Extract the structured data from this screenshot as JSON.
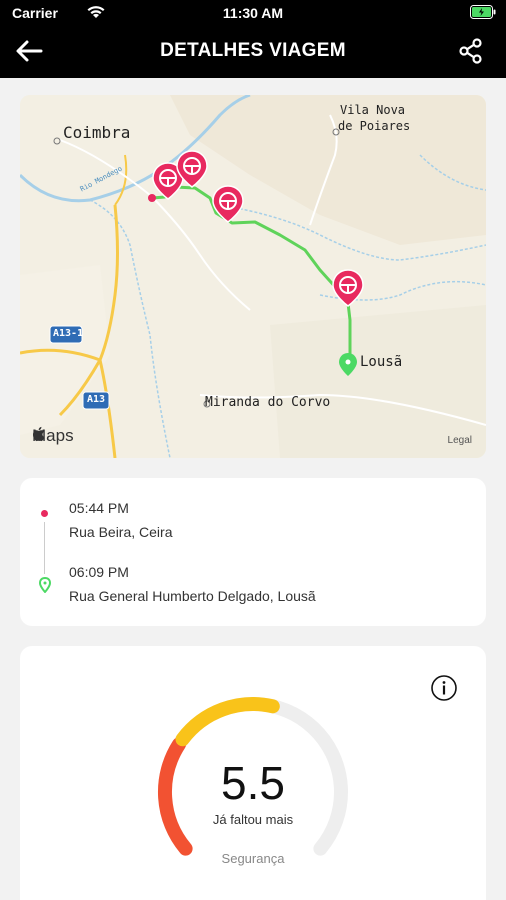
{
  "status_bar": {
    "carrier": "Carrier",
    "time": "11:30 AM"
  },
  "nav": {
    "title": "DETALHES VIAGEM",
    "back_icon": "arrow-left-icon",
    "share_icon": "share-icon"
  },
  "map": {
    "labels": {
      "coimbra": "Coimbra",
      "vila_nova_1": "Vila Nova",
      "vila_nova_2": "de Poiares",
      "lousa": "Lousã",
      "miranda": "Miranda do Corvo",
      "river": "Rio Mondego",
      "road_a13_1": "A13-1",
      "road_a13": "A13"
    },
    "brand": "Maps",
    "legal": "Legal",
    "route_color": "#5fd35a",
    "marker_color": "#e8295f"
  },
  "trip": {
    "start_time": "05:44 PM",
    "start_address": "Rua Beira, Ceira",
    "end_time": "06:09 PM",
    "end_address": "Rua General Humberto Delgado, Lousã",
    "start_color": "#e8295f",
    "end_color": "#4cd964"
  },
  "safety": {
    "score": "5.5",
    "message": "Já faltou mais",
    "label": "Segurança",
    "gauge_value": 5.5,
    "gauge_max": 10,
    "colors": {
      "low": "#f25232",
      "mid": "#f9c31a",
      "track": "#eeeeee"
    }
  }
}
